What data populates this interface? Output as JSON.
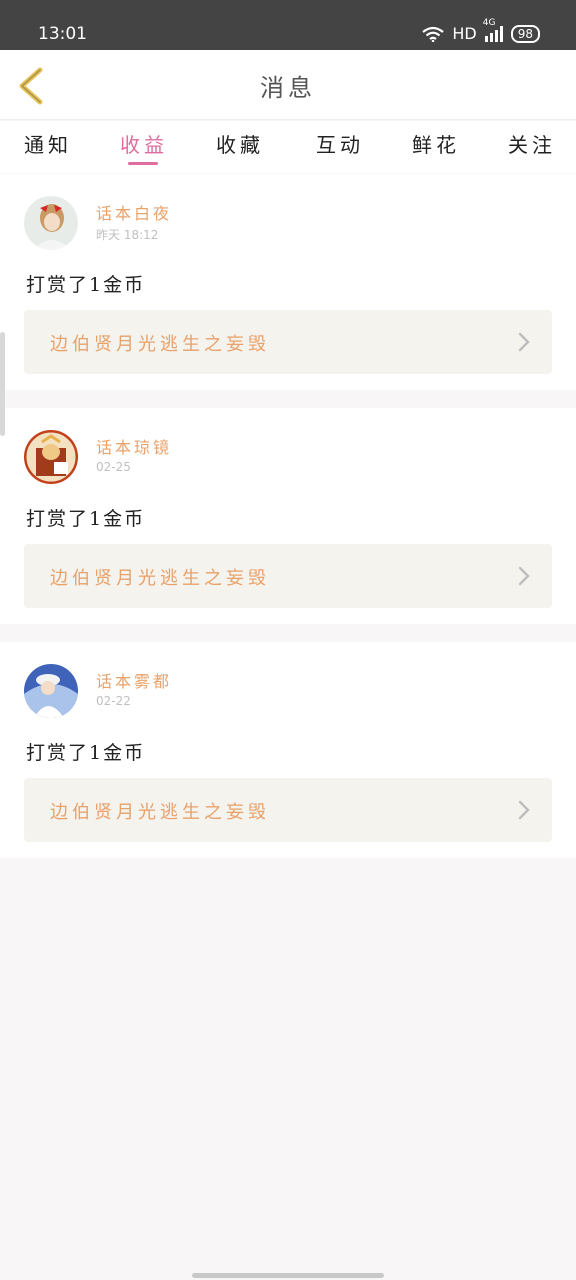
{
  "status_bar": {
    "time": "13:01",
    "network": "HD",
    "signal_label": "4G",
    "battery": "98"
  },
  "header": {
    "title": "消息",
    "back_icon": "chevron-left-icon",
    "back_color": "#e6c35a"
  },
  "tabs": [
    {
      "label": "通知",
      "active": false
    },
    {
      "label": "收益",
      "active": true
    },
    {
      "label": "收藏",
      "active": false
    },
    {
      "label": "互动",
      "active": false
    },
    {
      "label": "鲜花",
      "active": false
    },
    {
      "label": "关注",
      "active": false
    }
  ],
  "colors": {
    "accent": "#e06ca0",
    "name": "#e9a16a",
    "book_bg": "#f4f3ee"
  },
  "messages": [
    {
      "user": "话本白夜",
      "time": "昨天 18:12",
      "text": "打赏了1金币",
      "book": "边伯贤月光逃生之妄毁"
    },
    {
      "user": "话本琼镜",
      "time": "02-25",
      "text": "打赏了1金币",
      "book": "边伯贤月光逃生之妄毁"
    },
    {
      "user": "话本雾都",
      "time": "02-22",
      "text": "打赏了1金币",
      "book": "边伯贤月光逃生之妄毁"
    }
  ]
}
